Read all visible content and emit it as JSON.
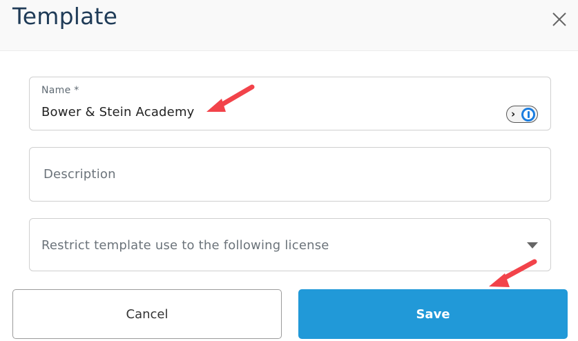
{
  "dialog": {
    "title": "Template"
  },
  "form": {
    "name": {
      "label": "Name *",
      "value": "Bower & Stein Academy"
    },
    "description": {
      "placeholder": "Description"
    },
    "license": {
      "placeholder": "Restrict template use to the following license"
    }
  },
  "buttons": {
    "cancel_label": "Cancel",
    "save_label": "Save"
  },
  "colors": {
    "title": "#1f3b57",
    "accent": "#2199d8",
    "annotation_arrow": "#f2434a",
    "password_manager_icon": "#1a7de0"
  },
  "icons": {
    "close": "close-icon",
    "password_manager": "password-manager-icon",
    "dropdown": "chevron-down-icon",
    "annotation": "annotation-arrow-icon"
  }
}
